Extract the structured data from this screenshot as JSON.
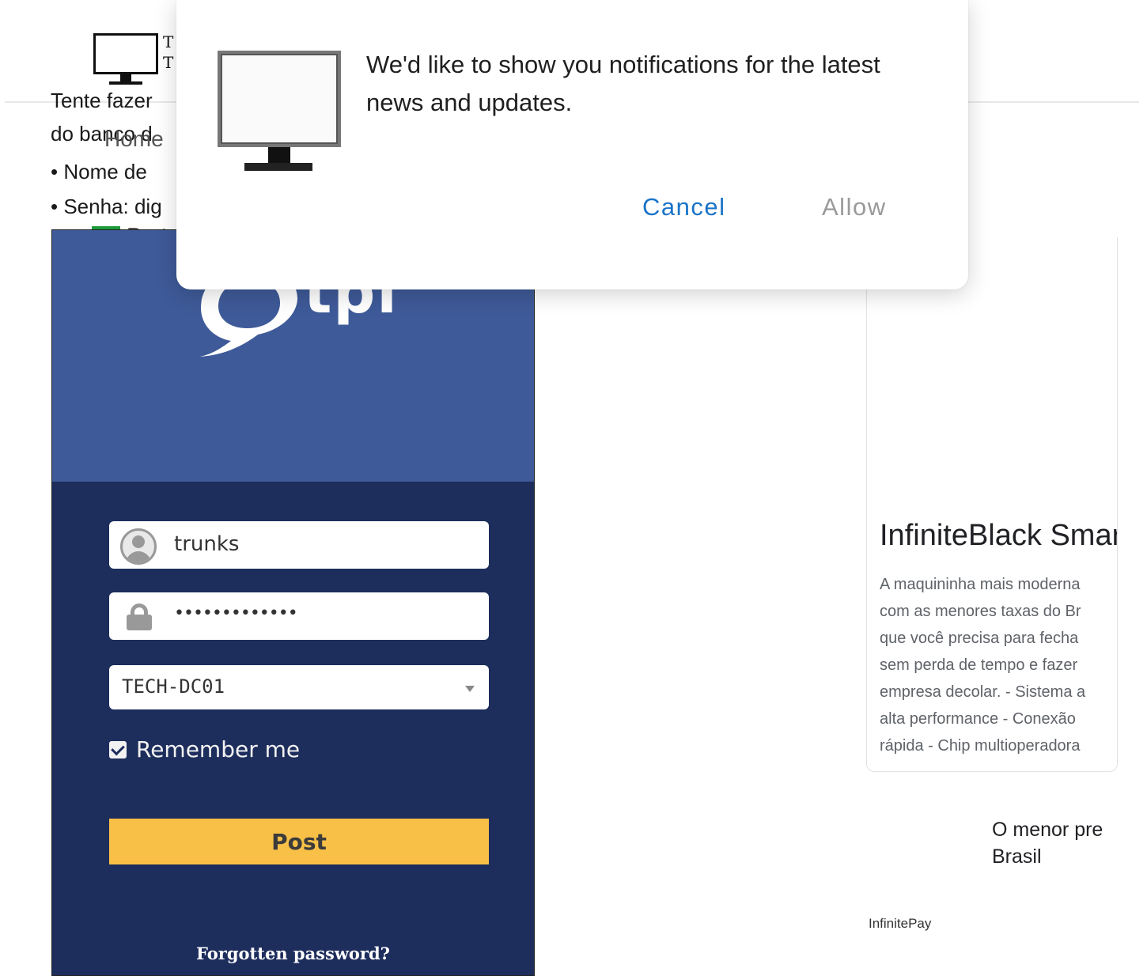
{
  "site": {
    "logo_text_line1": "T",
    "logo_text_line2": "T",
    "nav_home": "Home",
    "nav_language": "Port"
  },
  "article": {
    "line1": "Tente fazer",
    "line2": "do banco d",
    "bullet1": "• Nome de",
    "bullet2": "• Senha: dig"
  },
  "login_image": {
    "logo_text": "tpi",
    "username": "trunks",
    "password_mask": "•••••••••••••",
    "domain": "TECH-DC01",
    "remember_label": "Remember me",
    "remember_checked": true,
    "post_label": "Post",
    "forgot_label": "Forgotten password?"
  },
  "ad": {
    "title": "InfiniteBlack Smart",
    "desc_lines": [
      "A maquininha mais moderna",
      "com as menores taxas do Br",
      "que você precisa para fecha",
      "sem perda de tempo e fazer",
      "empresa decolar. - Sistema a",
      "alta performance - Conexão",
      "rápida - Chip multioperadora"
    ],
    "subtitle_line1": "O menor pre",
    "subtitle_line2": "Brasil",
    "brand": "InfinitePay"
  },
  "notification": {
    "message": "We'd like to show you notifications for the latest news and updates.",
    "cancel_label": "Cancel",
    "allow_label": "Allow"
  },
  "colors": {
    "cancel": "#1a73c8",
    "allow": "#9a9a9a",
    "login_top": "#3e5a98",
    "login_bottom": "#1d2d5c",
    "post_button": "#f8c047"
  }
}
